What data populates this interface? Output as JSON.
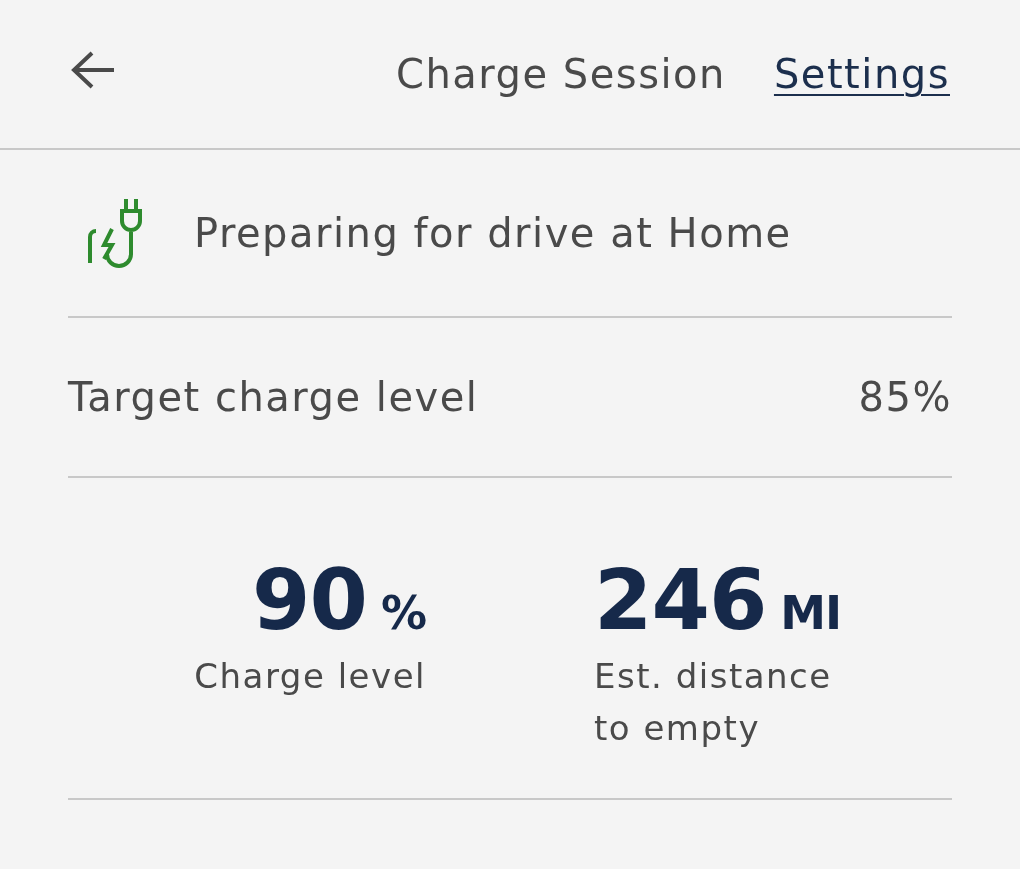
{
  "header": {
    "title": "Charge Session",
    "link": "Settings"
  },
  "status": {
    "text": "Preparing for drive at Home"
  },
  "target": {
    "label": "Target charge level",
    "value": "85%"
  },
  "stats": [
    {
      "value": "90",
      "unit": "%",
      "label": "Charge level"
    },
    {
      "value": "246",
      "unit": "MI",
      "label": "Est. distance to empty"
    }
  ]
}
